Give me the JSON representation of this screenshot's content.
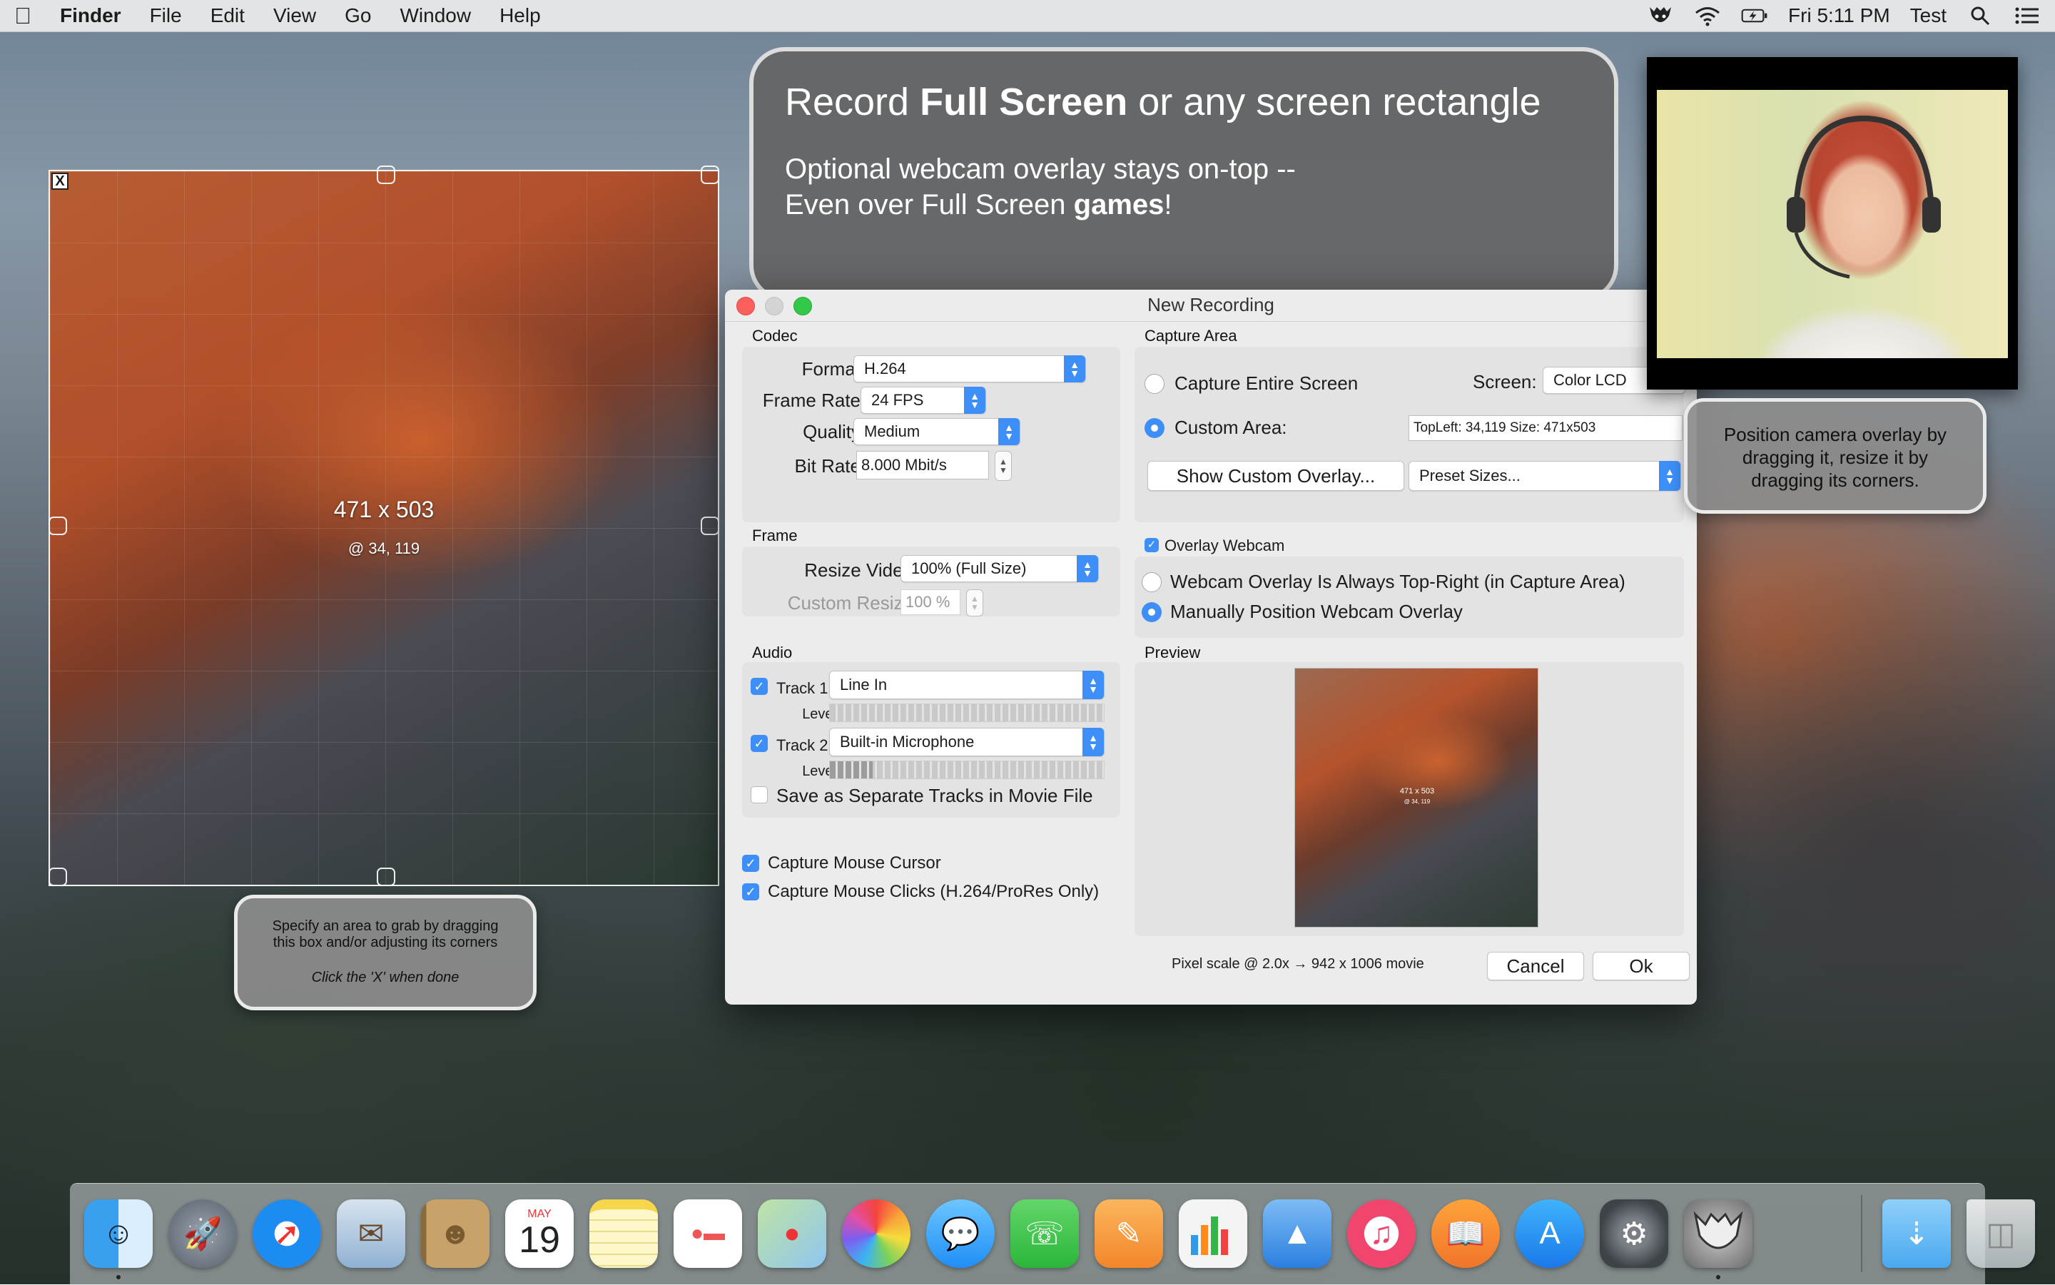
{
  "menubar": {
    "app": "Finder",
    "items": [
      "File",
      "Edit",
      "View",
      "Go",
      "Window",
      "Help"
    ],
    "clock": "Fri 5:11 PM",
    "user": "Test",
    "status_icons": [
      "screen-recorder-icon",
      "wifi-icon",
      "battery-charging-icon",
      "spotlight-icon",
      "notification-center-icon"
    ]
  },
  "selection": {
    "close_label": "X",
    "size_text": "471 x 503",
    "position_text": "@ 34, 119"
  },
  "callouts": {
    "area_line1": "Specify an area to grab by dragging",
    "area_line2": "this box and/or adjusting its corners",
    "area_line3": "Click the 'X' when done",
    "headline_part1": "Record ",
    "headline_bold": "Full Screen",
    "headline_part2": " or any screen rectangle",
    "sub_line1": "Optional webcam overlay stays on-top --",
    "sub_line2_part1": "Even over Full Screen ",
    "sub_line2_bold": "games",
    "sub_line2_part2": "!",
    "cam_line1": "Position camera overlay by",
    "cam_line2": "dragging it, resize it by",
    "cam_line3": "dragging its corners."
  },
  "dialog": {
    "title": "New Recording",
    "codec": {
      "section": "Codec",
      "format_label": "Format",
      "format_value": "H.264",
      "framerate_label": "Frame Rate",
      "framerate_value": "24 FPS",
      "quality_label": "Quality",
      "quality_value": "Medium",
      "bitrate_label": "Bit Rate",
      "bitrate_value": "8.000 Mbit/s"
    },
    "frame": {
      "section": "Frame",
      "resize_label": "Resize Video",
      "resize_value": "100% (Full Size)",
      "custom_label": "Custom Resize",
      "custom_value": "100 %"
    },
    "audio": {
      "section": "Audio",
      "track1_label": "Track 1",
      "track1_value": "Line In",
      "track2_label": "Track 2",
      "track2_value": "Built-in Microphone",
      "level_label": "Level",
      "separate_label": "Save as Separate Tracks in Movie File"
    },
    "capture_cursor": "Capture Mouse Cursor",
    "capture_clicks": "Capture Mouse Clicks (H.264/ProRes Only)",
    "capture_area": {
      "section": "Capture Area",
      "entire_label": "Capture Entire Screen",
      "screen_label": "Screen:",
      "screen_value": "Color LCD",
      "custom_label": "Custom Area:",
      "custom_value": "TopLeft: 34,119  Size: 471x503",
      "show_overlay_button": "Show Custom Overlay...",
      "preset_value": "Preset Sizes..."
    },
    "webcam": {
      "overlay_label": "Overlay Webcam",
      "top_right_label": "Webcam Overlay Is Always Top-Right (in Capture Area)",
      "manual_label": "Manually Position Webcam Overlay"
    },
    "preview": {
      "section": "Preview",
      "thumb_size": "471 x 503",
      "thumb_pos": "@ 34, 119"
    },
    "footer": {
      "pixel_scale": "Pixel scale @ 2.0x → 942 x 1006 movie",
      "cancel": "Cancel",
      "ok": "Ok"
    }
  },
  "calendar_icon": {
    "month": "MAY",
    "day": "19"
  },
  "dock": [
    "finder-icon",
    "launchpad-icon",
    "safari-icon",
    "mail-icon",
    "contacts-icon",
    "calendar-icon",
    "notes-icon",
    "reminders-icon",
    "maps-icon",
    "photos-icon",
    "messages-icon",
    "facetime-icon",
    "pages-icon",
    "numbers-icon",
    "keynote-icon",
    "itunes-icon",
    "ibooks-icon",
    "app-store-icon",
    "system-preferences-icon",
    "screen-recorder-app-icon",
    "downloads-folder-icon",
    "trash-icon"
  ]
}
